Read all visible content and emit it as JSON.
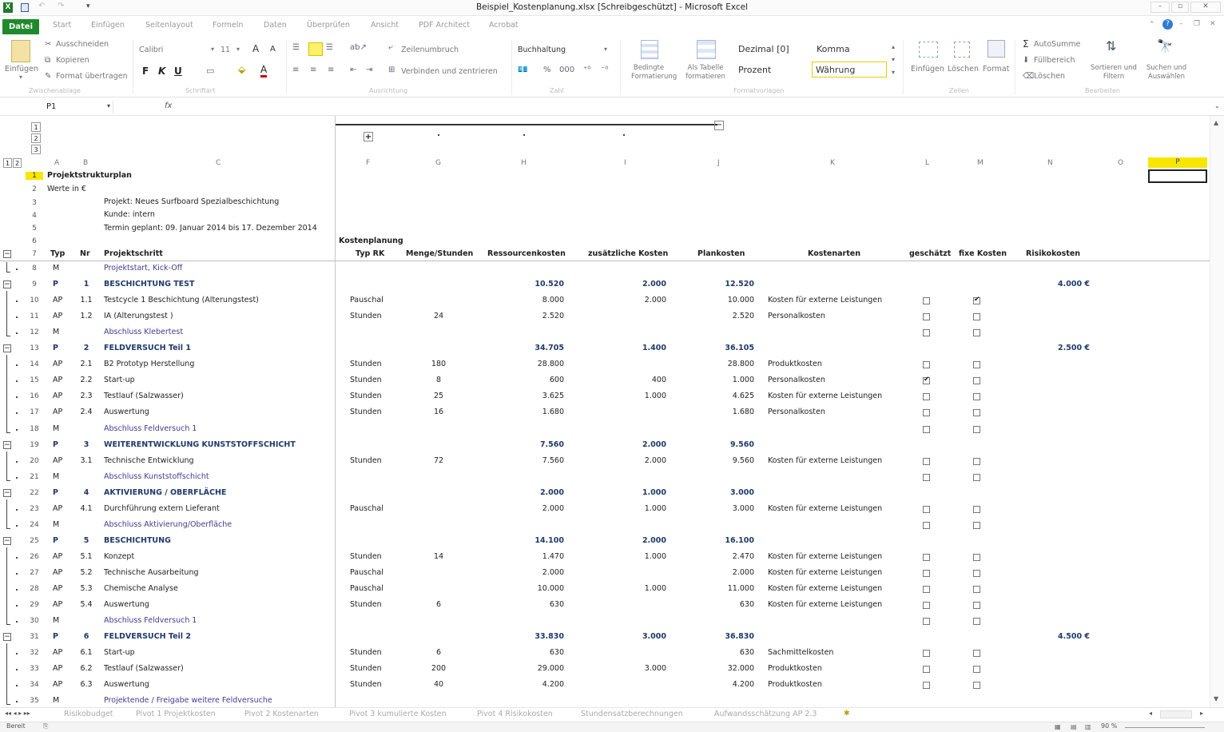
{
  "window": {
    "title": "Beispiel_Kostenplanung.xlsx [Schreibgeschützt] - Microsoft Excel"
  },
  "tabs": [
    "Start",
    "Einfügen",
    "Seitenlayout",
    "Formeln",
    "Daten",
    "Überprüfen",
    "Ansicht",
    "PDF Architect",
    "Acrobat"
  ],
  "file_tab": "Datei",
  "ribbon": {
    "clipboard": {
      "paste": "Einfügen",
      "cut": "Ausschneiden",
      "copy": "Kopieren",
      "format_painter": "Format übertragen",
      "group": "Zwischenablage"
    },
    "font": {
      "name": "Calibri",
      "size": "11",
      "group": "Schriftart"
    },
    "alignment": {
      "wrap": "Zeilenumbruch",
      "merge": "Verbinden und zentrieren",
      "group": "Ausrichtung"
    },
    "number": {
      "format": "Buchhaltung",
      "group": "Zahl"
    },
    "styles": {
      "cond": "Bedingte Formatierung",
      "table": "Als Tabelle formatieren",
      "s1": "Dezimal [0]",
      "s2": "Komma",
      "s3": "Prozent",
      "s4": "Währung",
      "group": "Formatvorlagen"
    },
    "cells": {
      "insert": "Einfügen",
      "delete": "Löschen",
      "format": "Format",
      "group": "Zellen"
    },
    "editing": {
      "autosum": "AutoSumme",
      "fill": "Füllbereich",
      "clear": "Löschen",
      "sort": "Sortieren und Filtern",
      "find": "Suchen und Auswählen",
      "group": "Bearbeiten"
    }
  },
  "namebox": "P1",
  "fx": "fx",
  "columns": [
    "A",
    "B",
    "C",
    "F",
    "G",
    "H",
    "I",
    "J",
    "K",
    "L",
    "M",
    "N",
    "O",
    "P"
  ],
  "outline_levels": [
    "1",
    "2",
    "3"
  ],
  "outline_rowlevels": [
    "1",
    "2"
  ],
  "header": {
    "a1": "Projektstrukturplan",
    "a2": "Werte in €",
    "c3": "Projekt: Neues Surfboard Spezialbeschichtung",
    "c4": "Kunde: intern",
    "c5": "Termin geplant: 09. Januar 2014 bis 17. Dezember 2014",
    "f6": "Kostenplanung"
  },
  "colheads": {
    "typ": "Typ",
    "nr": "Nr",
    "schritt": "Projektschritt",
    "typrk": "Typ RK",
    "menge": "Menge/Stunden",
    "ress": "Ressourcenkosten",
    "zus": "zusätzliche Kosten",
    "plan": "Plankosten",
    "arten": "Kostenarten",
    "gesch": "geschätzt",
    "fix": "fixe Kosten",
    "risiko": "Risikokosten"
  },
  "rows": [
    {
      "n": "8",
      "typ": "M",
      "nr": "",
      "s": "Projektstart, Kick-Off",
      "rk": "",
      "m": "",
      "h": "",
      "i": "",
      "j": "",
      "k": "",
      "cbL": null,
      "cbM": null,
      "risk": ""
    },
    {
      "n": "9",
      "typ": "P",
      "nr": "1",
      "s": "BESCHICHTUNG TEST",
      "rk": "",
      "m": "",
      "h": "10.520",
      "i": "2.000",
      "j": "12.520",
      "k": "",
      "cbL": null,
      "cbM": null,
      "risk": "4.000 €"
    },
    {
      "n": "10",
      "typ": "AP",
      "nr": "1.1",
      "s": "Testcycle 1 Beschichtung (Alterungstest)",
      "rk": "Pauschal",
      "m": "",
      "h": "8.000",
      "i": "2.000",
      "j": "10.000",
      "k": "Kosten für externe Leistungen",
      "cbL": false,
      "cbM": true,
      "risk": ""
    },
    {
      "n": "11",
      "typ": "AP",
      "nr": "1.2",
      "s": "IA (Alterungstest )",
      "rk": "Stunden",
      "m": "24",
      "h": "2.520",
      "i": "",
      "j": "2.520",
      "k": "Personalkosten",
      "cbL": false,
      "cbM": false,
      "risk": ""
    },
    {
      "n": "12",
      "typ": "M",
      "nr": "",
      "s": "Abschluss Klebertest",
      "rk": "",
      "m": "",
      "h": "",
      "i": "",
      "j": "",
      "k": "",
      "cbL": false,
      "cbM": false,
      "risk": ""
    },
    {
      "n": "13",
      "typ": "P",
      "nr": "2",
      "s": "FELDVERSUCH Teil 1",
      "rk": "",
      "m": "",
      "h": "34.705",
      "i": "1.400",
      "j": "36.105",
      "k": "",
      "cbL": null,
      "cbM": null,
      "risk": "2.500 €"
    },
    {
      "n": "14",
      "typ": "AP",
      "nr": "2.1",
      "s": "B2 Prototyp Herstellung",
      "rk": "Stunden",
      "m": "180",
      "h": "28.800",
      "i": "",
      "j": "28.800",
      "k": "Produktkosten",
      "cbL": false,
      "cbM": false,
      "risk": ""
    },
    {
      "n": "15",
      "typ": "AP",
      "nr": "2.2",
      "s": "Start-up",
      "rk": "Stunden",
      "m": "8",
      "h": "600",
      "i": "400",
      "j": "1.000",
      "k": "Personalkosten",
      "cbL": true,
      "cbM": false,
      "risk": ""
    },
    {
      "n": "16",
      "typ": "AP",
      "nr": "2.3",
      "s": "Testlauf (Salzwasser)",
      "rk": "Stunden",
      "m": "25",
      "h": "3.625",
      "i": "1.000",
      "j": "4.625",
      "k": "Kosten für externe Leistungen",
      "cbL": false,
      "cbM": false,
      "risk": ""
    },
    {
      "n": "17",
      "typ": "AP",
      "nr": "2.4",
      "s": "Auswertung",
      "rk": "Stunden",
      "m": "16",
      "h": "1.680",
      "i": "",
      "j": "1.680",
      "k": "Personalkosten",
      "cbL": false,
      "cbM": false,
      "risk": ""
    },
    {
      "n": "18",
      "typ": "M",
      "nr": "",
      "s": "Abschluss Feldversuch 1",
      "rk": "",
      "m": "",
      "h": "",
      "i": "",
      "j": "",
      "k": "",
      "cbL": false,
      "cbM": false,
      "risk": ""
    },
    {
      "n": "19",
      "typ": "P",
      "nr": "3",
      "s": "WEITERENTWICKLUNG KUNSTSTOFFSCHICHT",
      "rk": "",
      "m": "",
      "h": "7.560",
      "i": "2.000",
      "j": "9.560",
      "k": "",
      "cbL": null,
      "cbM": null,
      "risk": ""
    },
    {
      "n": "20",
      "typ": "AP",
      "nr": "3.1",
      "s": "Technische Entwicklung",
      "rk": "Stunden",
      "m": "72",
      "h": "7.560",
      "i": "2.000",
      "j": "9.560",
      "k": "Kosten für externe Leistungen",
      "cbL": false,
      "cbM": false,
      "risk": ""
    },
    {
      "n": "21",
      "typ": "M",
      "nr": "",
      "s": "Abschluss Kunststoffschicht",
      "rk": "",
      "m": "",
      "h": "",
      "i": "",
      "j": "",
      "k": "",
      "cbL": false,
      "cbM": false,
      "risk": ""
    },
    {
      "n": "22",
      "typ": "P",
      "nr": "4",
      "s": "AKTIVIERUNG / OBERFLÄCHE",
      "rk": "",
      "m": "",
      "h": "2.000",
      "i": "1.000",
      "j": "3.000",
      "k": "",
      "cbL": null,
      "cbM": null,
      "risk": ""
    },
    {
      "n": "23",
      "typ": "AP",
      "nr": "4.1",
      "s": "Durchführung extern Lieferant",
      "rk": "Pauschal",
      "m": "",
      "h": "2.000",
      "i": "1.000",
      "j": "3.000",
      "k": "Kosten für externe Leistungen",
      "cbL": false,
      "cbM": false,
      "risk": ""
    },
    {
      "n": "24",
      "typ": "M",
      "nr": "",
      "s": "Abschluss Aktivierung/Oberfläche",
      "rk": "",
      "m": "",
      "h": "",
      "i": "",
      "j": "",
      "k": "",
      "cbL": false,
      "cbM": false,
      "risk": ""
    },
    {
      "n": "25",
      "typ": "P",
      "nr": "5",
      "s": "BESCHICHTUNG",
      "rk": "",
      "m": "",
      "h": "14.100",
      "i": "2.000",
      "j": "16.100",
      "k": "",
      "cbL": null,
      "cbM": null,
      "risk": ""
    },
    {
      "n": "26",
      "typ": "AP",
      "nr": "5.1",
      "s": "Konzept",
      "rk": "Stunden",
      "m": "14",
      "h": "1.470",
      "i": "1.000",
      "j": "2.470",
      "k": "Kosten für externe Leistungen",
      "cbL": false,
      "cbM": false,
      "risk": ""
    },
    {
      "n": "27",
      "typ": "AP",
      "nr": "5.2",
      "s": "Technische Ausarbeitung",
      "rk": "Pauschal",
      "m": "",
      "h": "2.000",
      "i": "",
      "j": "2.000",
      "k": "Kosten für externe Leistungen",
      "cbL": false,
      "cbM": false,
      "risk": ""
    },
    {
      "n": "28",
      "typ": "AP",
      "nr": "5.3",
      "s": "Chemische Analyse",
      "rk": "Pauschal",
      "m": "",
      "h": "10.000",
      "i": "1.000",
      "j": "11.000",
      "k": "Kosten für externe Leistungen",
      "cbL": false,
      "cbM": false,
      "risk": ""
    },
    {
      "n": "29",
      "typ": "AP",
      "nr": "5.4",
      "s": "Auswertung",
      "rk": "Stunden",
      "m": "6",
      "h": "630",
      "i": "",
      "j": "630",
      "k": "Kosten für externe Leistungen",
      "cbL": false,
      "cbM": false,
      "risk": ""
    },
    {
      "n": "30",
      "typ": "M",
      "nr": "",
      "s": "Abschluss Feldversuch 1",
      "rk": "",
      "m": "",
      "h": "",
      "i": "",
      "j": "",
      "k": "",
      "cbL": false,
      "cbM": false,
      "risk": ""
    },
    {
      "n": "31",
      "typ": "P",
      "nr": "6",
      "s": "FELDVERSUCH Teil 2",
      "rk": "",
      "m": "",
      "h": "33.830",
      "i": "3.000",
      "j": "36.830",
      "k": "",
      "cbL": null,
      "cbM": null,
      "risk": "4.500 €"
    },
    {
      "n": "32",
      "typ": "AP",
      "nr": "6.1",
      "s": "Start-up",
      "rk": "Stunden",
      "m": "6",
      "h": "630",
      "i": "",
      "j": "630",
      "k": "Sachmittelkosten",
      "cbL": false,
      "cbM": false,
      "risk": ""
    },
    {
      "n": "33",
      "typ": "AP",
      "nr": "6.2",
      "s": "Testlauf (Salzwasser)",
      "rk": "Stunden",
      "m": "200",
      "h": "29.000",
      "i": "3.000",
      "j": "32.000",
      "k": "Produktkosten",
      "cbL": false,
      "cbM": false,
      "risk": ""
    },
    {
      "n": "34",
      "typ": "AP",
      "nr": "6.3",
      "s": "Auswertung",
      "rk": "Stunden",
      "m": "40",
      "h": "4.200",
      "i": "",
      "j": "4.200",
      "k": "Produktkosten",
      "cbL": false,
      "cbM": false,
      "risk": ""
    },
    {
      "n": "35",
      "typ": "M",
      "nr": "",
      "s": "Projektende / Freigabe weitere Feldversuche",
      "rk": "",
      "m": "",
      "h": "",
      "i": "",
      "j": "",
      "k": "",
      "cbL": null,
      "cbM": null,
      "risk": ""
    }
  ],
  "sheets": [
    "Risikobudget",
    "Pivot 1 Projektkosten",
    "Pivot 2 Kostenarten",
    "Pivot 3 kumulierte Kosten",
    "Pivot 4 Risikokosten",
    "Stundensatzberechnungen",
    "Aufwandsschätzung AP 2.3"
  ],
  "status": {
    "ready": "Bereit",
    "zoom": "90 %"
  },
  "colors": {
    "file_tab": "#1f8a2c",
    "selected_col": "#f7e600",
    "milestone_text": "#3d3d8f"
  }
}
